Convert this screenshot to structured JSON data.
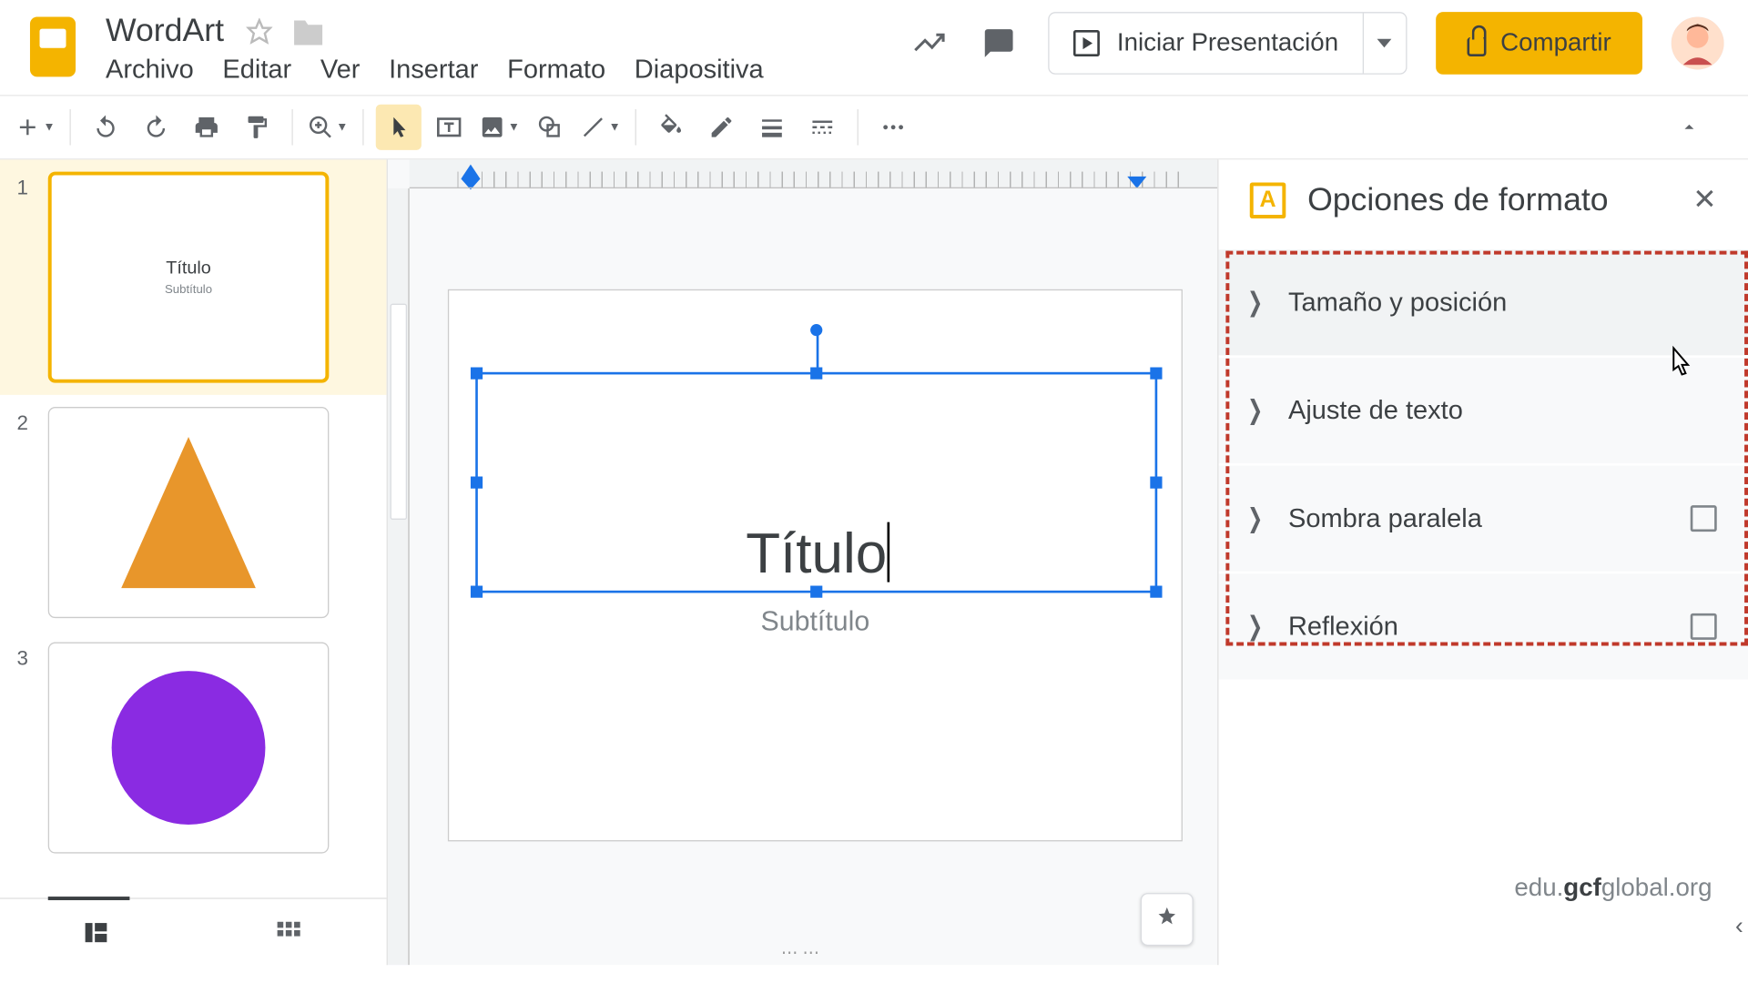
{
  "doc": {
    "title": "WordArt"
  },
  "menus": [
    "Archivo",
    "Editar",
    "Ver",
    "Insertar",
    "Formato",
    "Diapositiva"
  ],
  "header_actions": {
    "present": "Iniciar Presentación",
    "share": "Compartir"
  },
  "thumbs": [
    {
      "num": "1",
      "title": "Título",
      "subtitle": "Subtítulo",
      "selected": true,
      "shape": "text"
    },
    {
      "num": "2",
      "shape": "triangle"
    },
    {
      "num": "3",
      "shape": "circle"
    }
  ],
  "slide": {
    "title": "Título",
    "subtitle": "Subtítulo"
  },
  "format_panel": {
    "title": "Opciones de formato",
    "icon_letter": "A",
    "items": [
      {
        "label": "Tamaño y posición",
        "checkbox": false
      },
      {
        "label": "Ajuste de texto",
        "checkbox": false
      },
      {
        "label": "Sombra paralela",
        "checkbox": true
      },
      {
        "label": "Reflexión",
        "checkbox": true
      }
    ]
  },
  "watermark": {
    "prefix": "edu.",
    "bold": "gcf",
    "suffix": "global.org"
  },
  "colors": {
    "accent": "#f4b400",
    "selection": "#1a73e8",
    "triangle": "#e8962b",
    "circle": "#8a2be2"
  }
}
